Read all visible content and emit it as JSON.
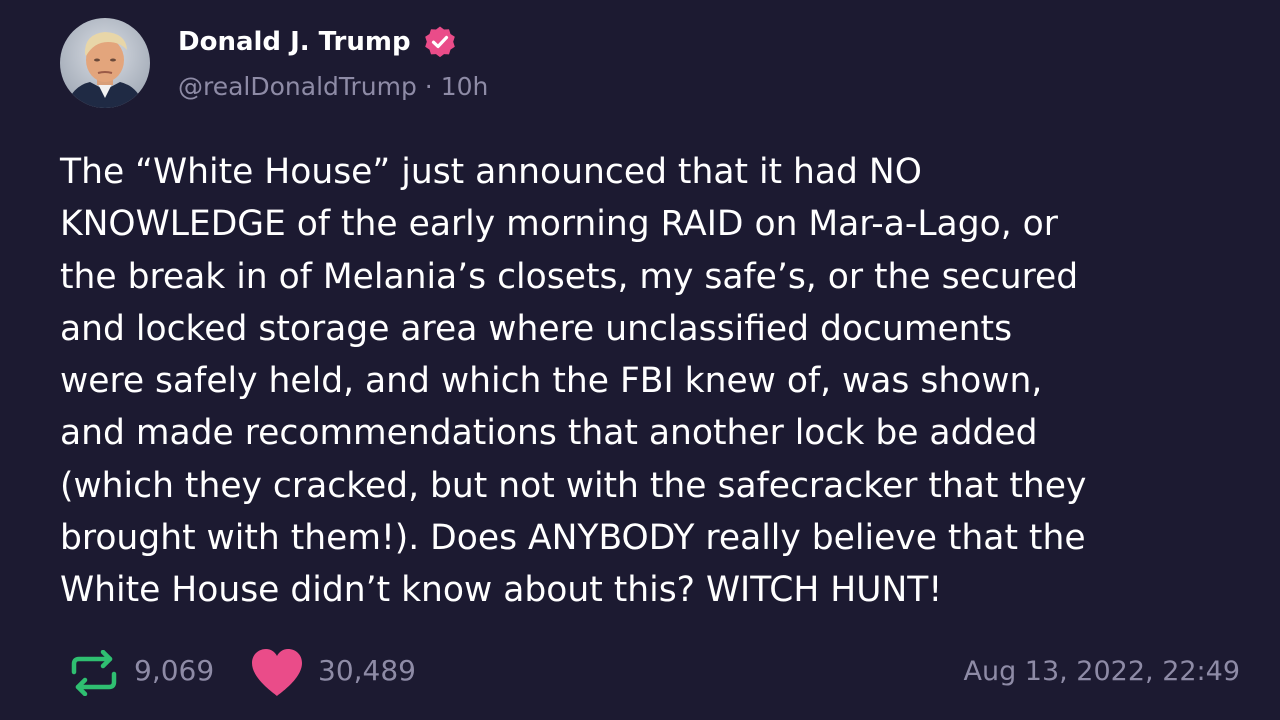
{
  "author": {
    "display_name": "Donald J. Trump",
    "handle": "@realDonaldTrump",
    "separator": "·",
    "time_ago": "10h",
    "avatar_icon": "avatar-portrait",
    "verified_icon": "verified-badge-icon"
  },
  "post": {
    "lines": [
      "The “White House” just announced that it had NO",
      "KNOWLEDGE of the early morning RAID on Mar-a-Lago, or",
      "the break in of Melania’s closets, my safe’s, or the secured",
      "and locked storage area where unclassified documents",
      "were safely held, and which the FBI knew of, was shown,",
      "and made recommendations that another lock be added",
      "(which they cracked, but not with the safecracker that they",
      "brought with them!). Does ANYBODY really believe that the",
      "White House didn’t know about this? WITCH HUNT!"
    ]
  },
  "stats": {
    "reposts": "9,069",
    "likes": "30,489",
    "repost_icon": "repost-icon",
    "like_icon": "heart-icon"
  },
  "timestamp": "Aug 13, 2022, 22:49",
  "colors": {
    "background": "#1c1a31",
    "text": "#ffffff",
    "muted": "#8e8ba6",
    "verified": "#ea4c89",
    "repost": "#2fbf71",
    "like": "#ea4c89"
  }
}
